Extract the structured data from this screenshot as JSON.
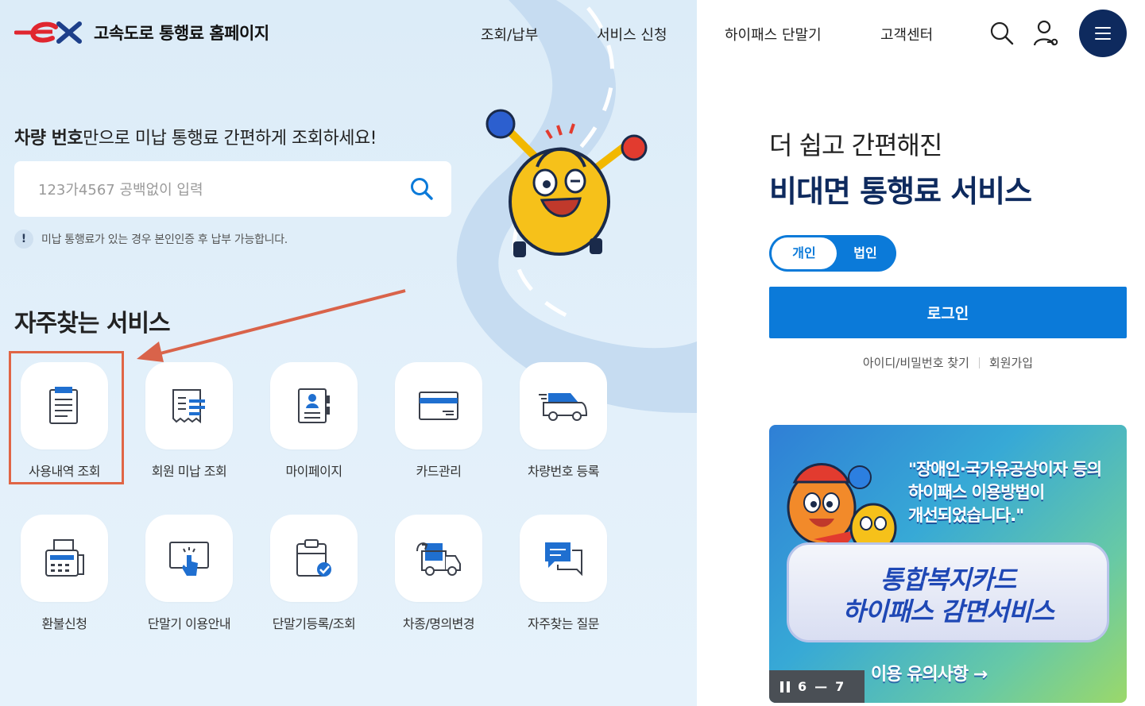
{
  "header": {
    "site_title": "고속도로 통행료 홈페이지",
    "nav": [
      "조회/납부",
      "서비스 신청",
      "하이패스 단말기",
      "고객센터"
    ]
  },
  "search": {
    "title_bold": "차량 번호",
    "title_rest": "만으로 미납 통행료 간편하게 조회하세요!",
    "placeholder": "123가4567 공백없이 입력",
    "notice_mark": "!",
    "notice": "미납 통행료가 있는 경우 본인인증 후 납부 가능합니다."
  },
  "frequent": {
    "title": "자주찾는 서비스",
    "items": [
      {
        "label": "사용내역 조회",
        "icon": "document-list-icon"
      },
      {
        "label": "회원 미납 조회",
        "icon": "receipt-icon"
      },
      {
        "label": "마이페이지",
        "icon": "profile-card-icon"
      },
      {
        "label": "카드관리",
        "icon": "credit-card-icon"
      },
      {
        "label": "차량번호 등록",
        "icon": "car-icon"
      },
      {
        "label": "환불신청",
        "icon": "fax-icon"
      },
      {
        "label": "단말기 이용안내",
        "icon": "touch-screen-icon"
      },
      {
        "label": "단말기등록/조회",
        "icon": "clipboard-check-icon"
      },
      {
        "label": "차종/명의변경",
        "icon": "truck-swap-icon"
      },
      {
        "label": "자주찾는 질문",
        "icon": "chat-bubbles-icon"
      }
    ]
  },
  "account": {
    "subtitle": "더 쉽고 간편해진",
    "title": "비대면 통행료 서비스",
    "toggle": [
      "개인",
      "법인"
    ],
    "toggle_active": "개인",
    "login": "로그인",
    "links": [
      "아이디/비밀번호 찾기",
      "회원가입"
    ]
  },
  "banner": {
    "quote_lines": [
      "\"장애인·국가유공상이자 등의",
      "하이패스 이용방법이",
      "개선되었습니다.\""
    ],
    "headline_1": "통합복지카드",
    "headline_2": "하이패스 감면서비스",
    "caution": "이용 유의사항 →",
    "current": "6",
    "total": "7"
  },
  "colors": {
    "primary": "#0b7ad9",
    "navy": "#0e2a5e",
    "logo_red": "#e0262f",
    "highlight": "#e06545"
  }
}
